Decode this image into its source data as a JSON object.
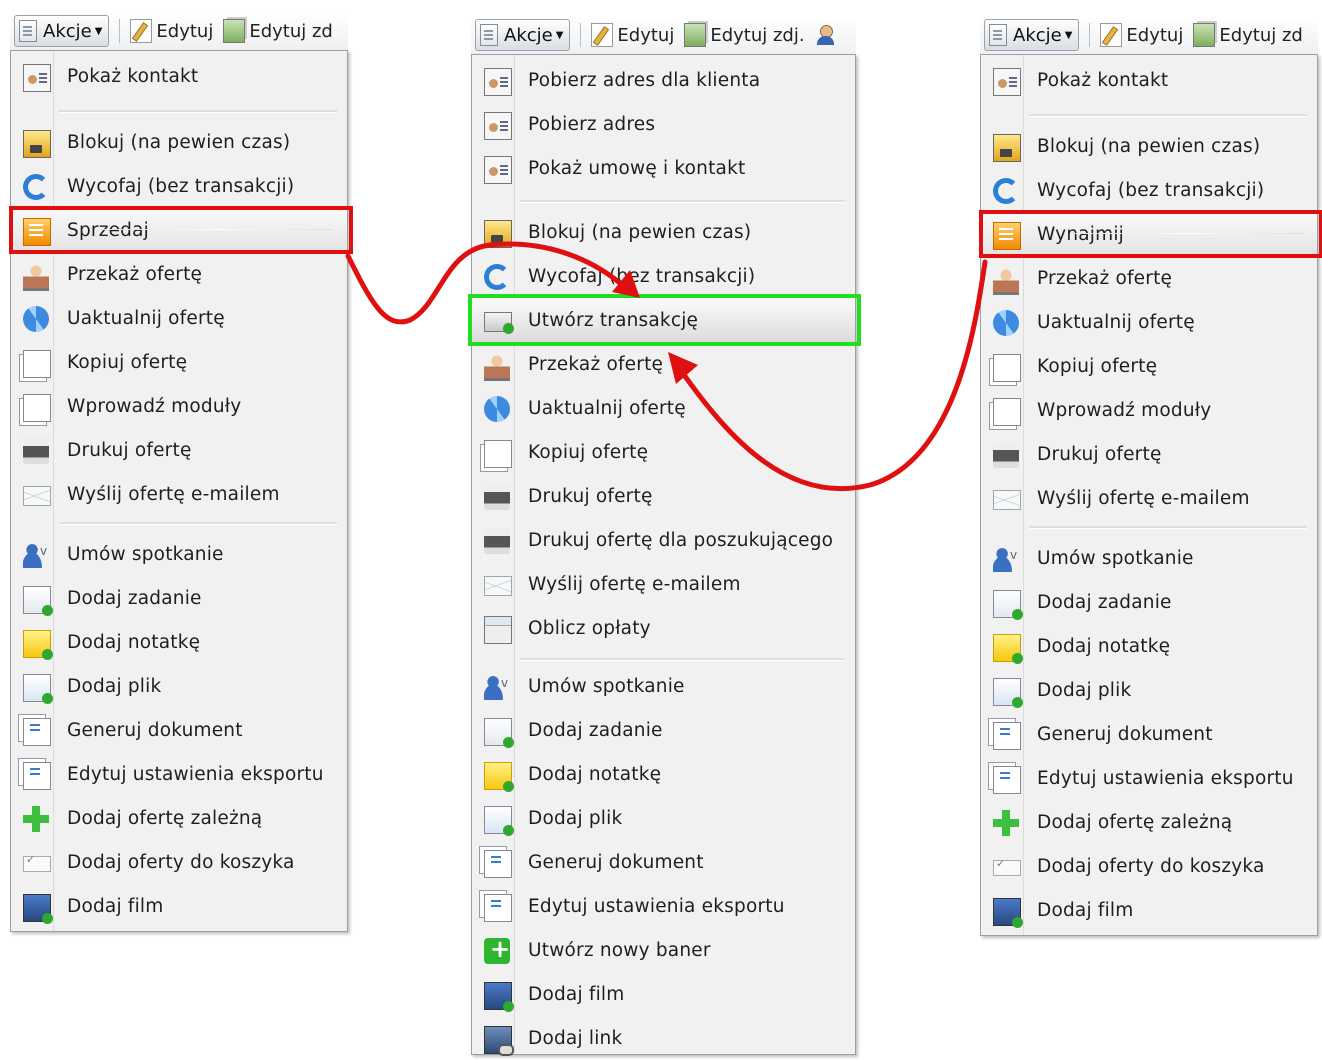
{
  "toolbar": {
    "akcje_label": "Akcje",
    "edytuj_label": "Edytuj",
    "edytuj_zd_label": "Edytuj zd",
    "edytuj_zdj_label": "Edytuj zdj."
  },
  "colors": {
    "highlight_red": "#e01010",
    "highlight_green": "#22dd22"
  },
  "left_menu": {
    "items": [
      {
        "label": "Pokaż kontakt",
        "icon": "contact-card-icon"
      },
      {
        "label": "Blokuj (na pewien czas)",
        "icon": "lock-calendar-icon"
      },
      {
        "label": "Wycofaj (bez transakcji)",
        "icon": "undo-arrow-icon"
      },
      {
        "label": "Sprzedaj",
        "icon": "sell-document-icon"
      },
      {
        "label": "Przekaż ofertę",
        "icon": "pass-offer-icon"
      },
      {
        "label": "Uaktualnij ofertę",
        "icon": "refresh-icon"
      },
      {
        "label": "Kopiuj ofertę",
        "icon": "copy-icon"
      },
      {
        "label": "Wprowadź moduły",
        "icon": "page-icon"
      },
      {
        "label": "Drukuj ofertę",
        "icon": "printer-icon"
      },
      {
        "label": "Wyślij ofertę e-mailem",
        "icon": "envelope-icon"
      },
      {
        "label": "Umów spotkanie",
        "icon": "meeting-user-icon"
      },
      {
        "label": "Dodaj zadanie",
        "icon": "add-task-icon"
      },
      {
        "label": "Dodaj notatkę",
        "icon": "add-note-icon"
      },
      {
        "label": "Dodaj plik",
        "icon": "add-file-icon"
      },
      {
        "label": "Generuj dokument",
        "icon": "generate-document-icon"
      },
      {
        "label": "Edytuj ustawienia eksportu",
        "icon": "export-settings-icon"
      },
      {
        "label": "Dodaj ofertę zależną",
        "icon": "green-plus-icon"
      },
      {
        "label": "Dodaj oferty do koszyka",
        "icon": "basket-checkbox-icon"
      },
      {
        "label": "Dodaj film",
        "icon": "add-film-icon"
      }
    ]
  },
  "middle_menu": {
    "items": [
      {
        "label": "Pobierz adres dla klienta",
        "icon": "contact-card-icon"
      },
      {
        "label": "Pobierz adres",
        "icon": "contact-card-icon"
      },
      {
        "label": "Pokaż umowę i kontakt",
        "icon": "contact-card-icon"
      },
      {
        "label": "Blokuj (na pewien czas)",
        "icon": "lock-calendar-icon"
      },
      {
        "label": "Wycofaj (bez transakcji)",
        "icon": "undo-arrow-icon"
      },
      {
        "label": "Utwórz transakcję",
        "icon": "create-transaction-icon"
      },
      {
        "label": "Przekaż ofertę",
        "icon": "pass-offer-icon"
      },
      {
        "label": "Uaktualnij ofertę",
        "icon": "refresh-icon"
      },
      {
        "label": "Kopiuj ofertę",
        "icon": "copy-icon"
      },
      {
        "label": "Drukuj ofertę",
        "icon": "printer-icon"
      },
      {
        "label": "Drukuj ofertę dla poszukującego",
        "icon": "printer-blue-icon"
      },
      {
        "label": "Wyślij ofertę e-mailem",
        "icon": "envelope-icon"
      },
      {
        "label": "Oblicz opłaty",
        "icon": "calculator-icon"
      },
      {
        "label": "Umów spotkanie",
        "icon": "meeting-user-icon"
      },
      {
        "label": "Dodaj zadanie",
        "icon": "add-task-icon"
      },
      {
        "label": "Dodaj notatkę",
        "icon": "add-note-icon"
      },
      {
        "label": "Dodaj plik",
        "icon": "add-file-icon"
      },
      {
        "label": "Generuj dokument",
        "icon": "generate-document-icon"
      },
      {
        "label": "Edytuj ustawienia eksportu",
        "icon": "export-settings-icon"
      },
      {
        "label": "Utwórz nowy baner",
        "icon": "new-banner-icon"
      },
      {
        "label": "Dodaj film",
        "icon": "add-film-icon"
      },
      {
        "label": "Dodaj link",
        "icon": "add-link-icon"
      }
    ]
  },
  "right_menu": {
    "items": [
      {
        "label": "Pokaż kontakt",
        "icon": "contact-card-icon"
      },
      {
        "label": "Blokuj (na pewien czas)",
        "icon": "lock-calendar-icon"
      },
      {
        "label": "Wycofaj (bez transakcji)",
        "icon": "undo-arrow-icon"
      },
      {
        "label": "Wynajmij",
        "icon": "rent-document-icon"
      },
      {
        "label": "Przekaż ofertę",
        "icon": "pass-offer-icon"
      },
      {
        "label": "Uaktualnij ofertę",
        "icon": "refresh-icon"
      },
      {
        "label": "Kopiuj ofertę",
        "icon": "copy-icon"
      },
      {
        "label": "Wprowadź moduły",
        "icon": "page-icon"
      },
      {
        "label": "Drukuj ofertę",
        "icon": "printer-icon"
      },
      {
        "label": "Wyślij ofertę e-mailem",
        "icon": "envelope-icon"
      },
      {
        "label": "Umów spotkanie",
        "icon": "meeting-user-icon"
      },
      {
        "label": "Dodaj zadanie",
        "icon": "add-task-icon"
      },
      {
        "label": "Dodaj notatkę",
        "icon": "add-note-icon"
      },
      {
        "label": "Dodaj plik",
        "icon": "add-file-icon"
      },
      {
        "label": "Generuj dokument",
        "icon": "generate-document-icon"
      },
      {
        "label": "Edytuj ustawienia eksportu",
        "icon": "export-settings-icon"
      },
      {
        "label": "Dodaj ofertę zależną",
        "icon": "green-plus-icon"
      },
      {
        "label": "Dodaj oferty do koszyka",
        "icon": "basket-checkbox-icon"
      },
      {
        "label": "Dodaj film",
        "icon": "add-film-icon"
      }
    ]
  }
}
